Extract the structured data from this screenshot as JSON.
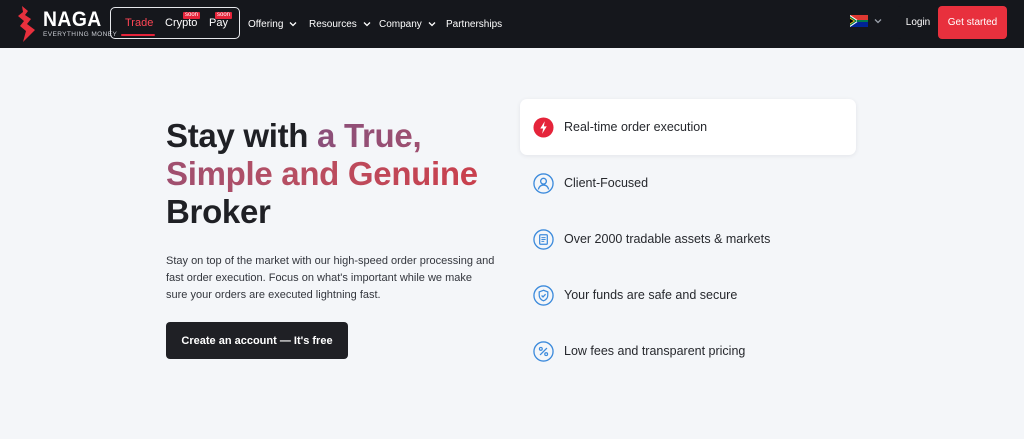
{
  "brand": {
    "name": "NAGA",
    "tagline": "EVERYTHING MONEY",
    "accent_color": "#e8303d"
  },
  "product_switcher": {
    "items": [
      {
        "label": "Trade",
        "active": true
      },
      {
        "label": "Crypto",
        "badge": "soon"
      },
      {
        "label": "Pay",
        "badge": "soon"
      }
    ]
  },
  "nav": {
    "items": [
      {
        "label": "Offering",
        "icon": "chevron-down-icon"
      },
      {
        "label": "Resources",
        "icon": "chevron-down-icon"
      },
      {
        "label": "Company",
        "icon": "chevron-down-icon"
      },
      {
        "label": "Partnerships"
      }
    ]
  },
  "header_actions": {
    "language_icon": "south-africa-flag-icon",
    "login_label": "Login",
    "get_started_label": "Get started"
  },
  "hero": {
    "title_start": "Stay with ",
    "title_accent": "a True, Simple and Genuine",
    "title_end": "Broker",
    "description": "Stay on top of the market with our high-speed order processing and fast order execution. Focus on what's important while we make sure your orders are executed lightning fast.",
    "cta_label": "Create an account — It's free"
  },
  "features": [
    {
      "label": "Real-time order execution",
      "icon": "lightning-icon",
      "active": true
    },
    {
      "label": "Client-Focused",
      "icon": "user-icon"
    },
    {
      "label": "Over 2000 tradable assets & markets",
      "icon": "document-list-icon"
    },
    {
      "label": "Your funds are safe and secure",
      "icon": "shield-check-icon"
    },
    {
      "label": "Low fees and transparent pricing",
      "icon": "percent-icon"
    }
  ],
  "colors": {
    "header_bg": "#15171c",
    "page_bg": "#f4f6f9",
    "icon_blue": "#3d8bdc",
    "title_gradient": [
      "#8a4f7a",
      "#c9404d"
    ]
  }
}
